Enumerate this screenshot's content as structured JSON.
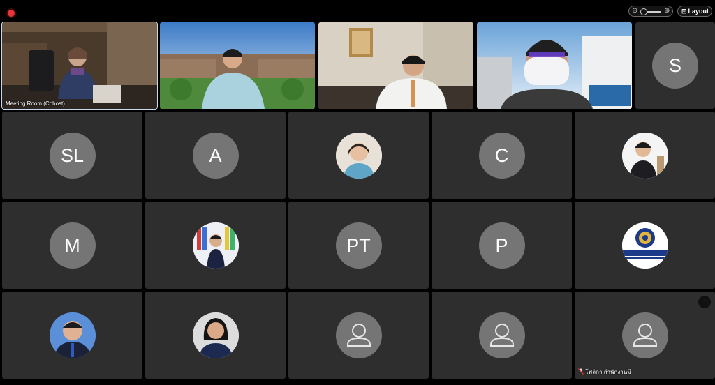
{
  "indicators": {
    "recording": true
  },
  "zoom": {
    "minus_icon": "⊖",
    "plus_icon": "⊕",
    "level": 0.15
  },
  "layout_button": {
    "icon": "⊞",
    "label": "Layout"
  },
  "colors": {
    "tile_bg": "#2e2e2e",
    "avatar_bg": "#757575",
    "page_bg": "#000000",
    "record": "#e8353b",
    "active_border": "#c8d8f0"
  },
  "top_row": [
    {
      "type": "video",
      "label": "Meeting Room (Cohost)",
      "active": true
    },
    {
      "type": "video",
      "label": ""
    },
    {
      "type": "video",
      "label": ""
    },
    {
      "type": "video",
      "label": ""
    },
    {
      "type": "initials",
      "initials": "S"
    }
  ],
  "grid_tiles": [
    {
      "type": "initials",
      "initials": "SL"
    },
    {
      "type": "initials",
      "initials": "A"
    },
    {
      "type": "photo",
      "photo": "woman-portrait"
    },
    {
      "type": "initials",
      "initials": "C"
    },
    {
      "type": "photo",
      "photo": "man-portrait"
    },
    {
      "type": "initials",
      "initials": "M"
    },
    {
      "type": "photo",
      "photo": "person-with-flags"
    },
    {
      "type": "initials",
      "initials": "PT"
    },
    {
      "type": "initials",
      "initials": "P"
    },
    {
      "type": "photo",
      "photo": "university-logo"
    },
    {
      "type": "photo",
      "photo": "man-in-suit"
    },
    {
      "type": "photo",
      "photo": "woman-smiling"
    },
    {
      "type": "generic",
      "icon": "default-user-icon"
    },
    {
      "type": "generic",
      "icon": "default-user-icon"
    },
    {
      "type": "generic",
      "icon": "default-user-icon",
      "label": "โฟลิกา สำนักงานมี",
      "more": "···",
      "muted_icon": "mic-off-icon"
    }
  ]
}
